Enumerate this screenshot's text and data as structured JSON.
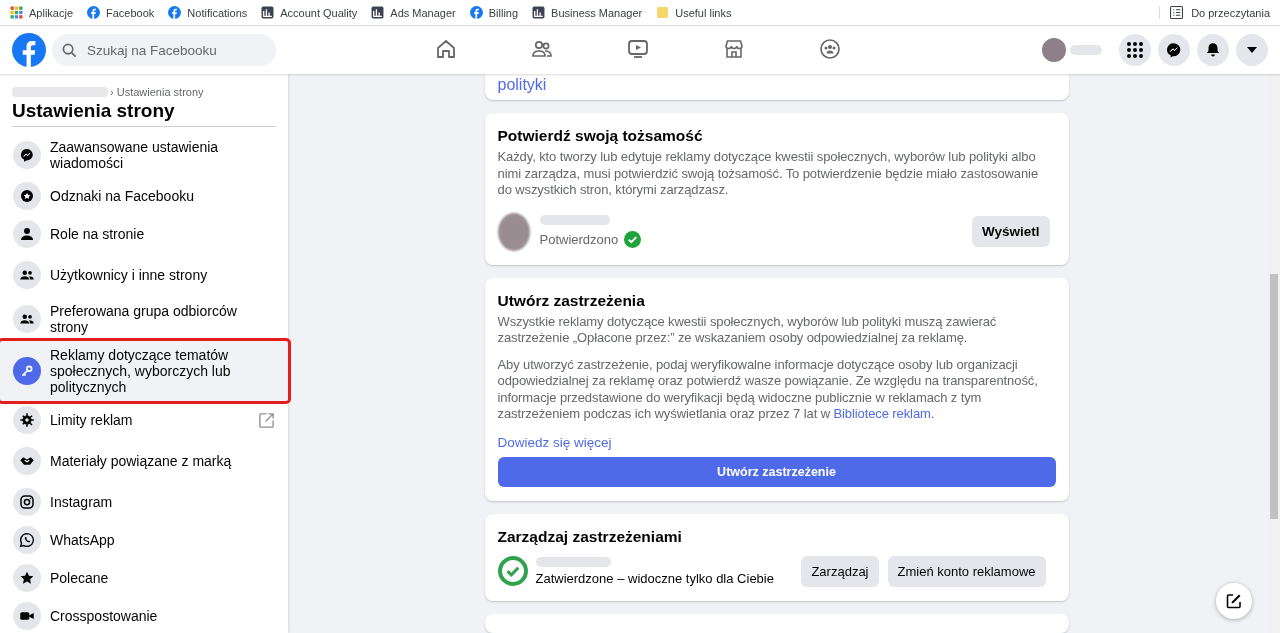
{
  "bookmarks": [
    {
      "label": "Aplikacje",
      "kind": "apps"
    },
    {
      "label": "Facebook",
      "kind": "facebook"
    },
    {
      "label": "Notifications",
      "kind": "facebook"
    },
    {
      "label": "Account Quality",
      "kind": "page"
    },
    {
      "label": "Ads Manager",
      "kind": "page"
    },
    {
      "label": "Billing",
      "kind": "facebook"
    },
    {
      "label": "Business Manager",
      "kind": "page"
    },
    {
      "label": "Useful links",
      "kind": "folder"
    }
  ],
  "reading_list": "Do przeczytania",
  "header": {
    "search": {
      "placeholder": "Szukaj na Facebooku"
    },
    "nav": [
      {
        "selected": false
      },
      {
        "selected": false
      },
      {
        "selected": false
      },
      {
        "selected": false
      },
      {
        "selected": false
      }
    ]
  },
  "sidebar": {
    "breadcrumb": "› Ustawienia strony",
    "title": "Ustawienia strony",
    "items": [
      {
        "label": "Zaawansowane ustawienia wiadomości",
        "selected": false,
        "external": false
      },
      {
        "label": "Odznaki na Facebooku",
        "selected": false,
        "external": false
      },
      {
        "label": "Role na stronie",
        "selected": false,
        "external": false
      },
      {
        "label": "Użytkownicy i inne strony",
        "selected": false,
        "external": false
      },
      {
        "label": "Preferowana grupa odbiorców strony",
        "selected": false,
        "external": false
      },
      {
        "label": "Reklamy dotyczące tematów społecznych, wyborczych lub politycznych",
        "selected": true,
        "external": false
      },
      {
        "label": "Limity reklam",
        "selected": false,
        "external": true
      },
      {
        "label": "Materiały powiązane z marką",
        "selected": false,
        "external": false
      },
      {
        "label": "Instagram",
        "selected": false,
        "external": false
      },
      {
        "label": "WhatsApp",
        "selected": false,
        "external": false
      },
      {
        "label": "Polecane",
        "selected": false,
        "external": false
      },
      {
        "label": "Crosspostowanie",
        "selected": false,
        "external": false
      }
    ]
  },
  "top_card": {
    "link": "polityki"
  },
  "identity_card": {
    "title": "Potwierdź swoją tożsamość",
    "text": "Każdy, kto tworzy lub edytuje reklamy dotyczące kwestii społecznych, wyborów lub polityki albo nimi zarządza, musi potwierdzić swoją tożsamość. To potwierdzenie będzie miało zastosowanie do wszystkich stron, którymi zarządzasz.",
    "status": "Potwierdzono",
    "verified": true,
    "button": "Wyświetl"
  },
  "disclaimer_card": {
    "title": "Utwórz zastrzeżenia",
    "text": "Wszystkie reklamy dotyczące kwestii społecznych, wyborów lub polityki muszą zawierać zastrzeżenie „Opłacone przez:” ze wskazaniem osoby odpowiedzialnej za reklamę.",
    "text2": "Aby utworzyć zastrzeżenie, podaj weryfikowalne informacje dotyczące osoby lub organizacji odpowiedzialnej za reklamę oraz potwierdź wasze powiązanie. Ze względu na transparentność, informacje przedstawione do weryfikacji będą widoczne publicznie w reklamach z tym zastrzeżeniem podczas ich wyświetlania oraz przez 7 lat w",
    "text2_link": "Bibliotece reklam",
    "text2_end": ".",
    "learn_more": "Dowiedz się więcej",
    "button": "Utwórz zastrzeżenie"
  },
  "manage_card": {
    "title": "Zarządzaj zastrzeżeniami",
    "status": "Zatwierdzone – widoczne tylko dla Ciebie",
    "approved": true,
    "buttons": [
      "Zarządzaj",
      "Zmień konto reklamowe"
    ]
  }
}
